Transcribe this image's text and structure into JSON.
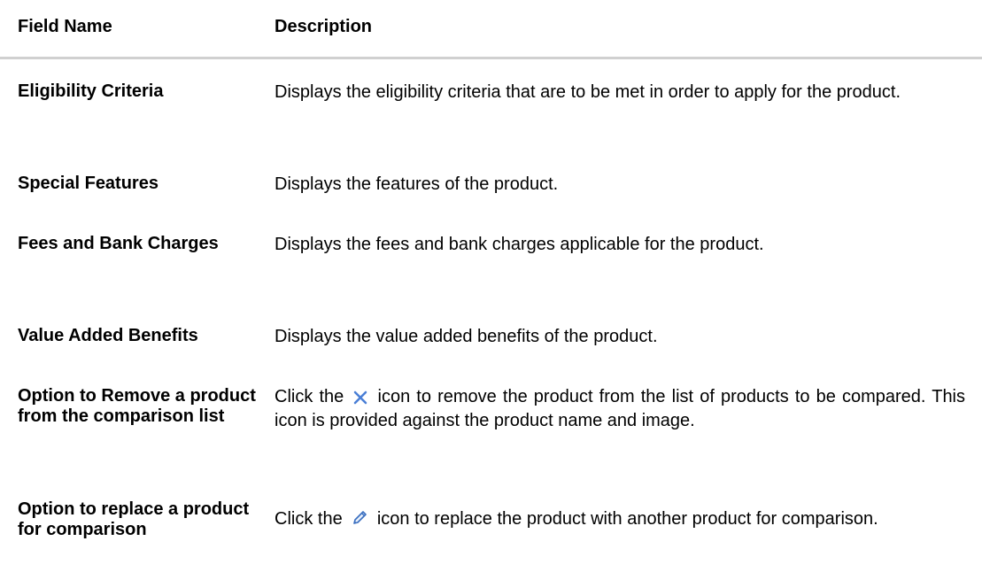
{
  "table": {
    "headers": {
      "field_name": "Field Name",
      "description": "Description"
    },
    "rows": [
      {
        "field": "Eligibility Criteria",
        "description": "Displays the eligibility criteria that are to be met in order to apply for the product."
      },
      {
        "field": "Special Features",
        "description": "Displays the features of the product."
      },
      {
        "field": "Fees and Bank Charges",
        "description": "Displays the fees and bank charges applicable for the product."
      },
      {
        "field": "Value Added Benefits",
        "description": "Displays the value added benefits of the product."
      },
      {
        "field": "Option to Remove a product from the comparison list",
        "description_before_icon": "Click the",
        "icon": "close-icon",
        "description_after_icon": "icon to remove the product from the list of products to be compared. This icon is provided against the product name and image."
      },
      {
        "field": "Option to replace a product for comparison",
        "description_before_icon": "Click the",
        "icon": "pencil-icon",
        "description_after_icon": "icon to replace the product with another product for comparison."
      }
    ]
  },
  "colors": {
    "close_icon": "#4a7fd6",
    "pencil_icon": "#3a6fc0",
    "rule": "#d0d0d0"
  }
}
